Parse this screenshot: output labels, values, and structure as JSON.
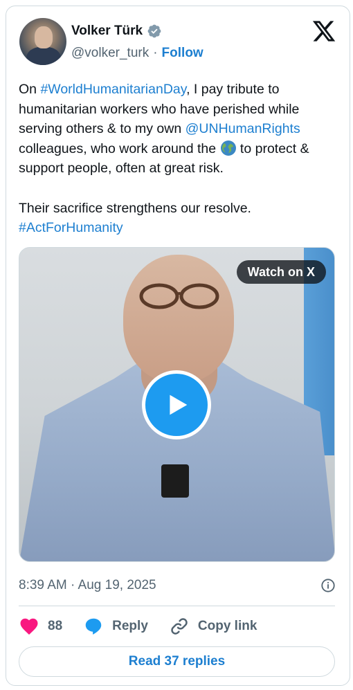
{
  "author": {
    "name": "Volker Türk",
    "handle": "@volker_turk",
    "separator": "·",
    "follow_label": "Follow"
  },
  "tweet": {
    "text_1": "On ",
    "hashtag_1": "#WorldHumanitarianDay",
    "text_2": ", I pay tribute to humanitarian workers who have perished while serving others & to my own ",
    "mention_1": "@UNHumanRights",
    "text_3": " colleagues, who work around the ",
    "text_4": " to protect & support people, often at great risk.\n\nTheir sacrifice strengthens our resolve.\n",
    "hashtag_2": "#ActForHumanity"
  },
  "media": {
    "watch_label": "Watch on X"
  },
  "meta": {
    "timestamp": "8:39 AM · Aug 19, 2025"
  },
  "actions": {
    "like_count": "88",
    "reply_label": "Reply",
    "copy_label": "Copy link"
  },
  "read_replies_label": "Read 37 replies",
  "colors": {
    "link": "#1d7fd0",
    "like": "#f91880",
    "reply": "#1d9bf0",
    "verified": "#829aab"
  }
}
